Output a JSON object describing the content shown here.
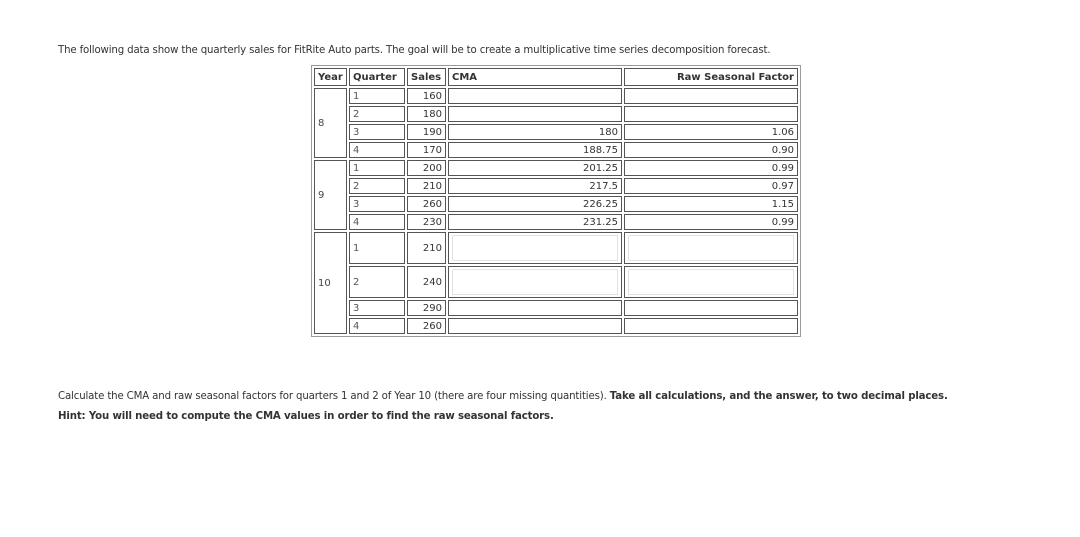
{
  "intro_text": "The following data show the quarterly sales for FitRite Auto parts. The goal will be to create a multiplicative time series decomposition forecast.",
  "table": {
    "headers": {
      "year": "Year",
      "quarter": "Quarter",
      "sales": "Sales",
      "cma": "CMA",
      "rsf": "Raw Seasonal Factor"
    },
    "groups": [
      {
        "year": "8",
        "rows": [
          {
            "quarter": "1",
            "sales": "160",
            "cma": "",
            "rsf": ""
          },
          {
            "quarter": "2",
            "sales": "180",
            "cma": "",
            "rsf": ""
          },
          {
            "quarter": "3",
            "sales": "190",
            "cma": "180",
            "rsf": "1.06"
          },
          {
            "quarter": "4",
            "sales": "170",
            "cma": "188.75",
            "rsf": "0.90"
          }
        ]
      },
      {
        "year": "9",
        "rows": [
          {
            "quarter": "1",
            "sales": "200",
            "cma": "201.25",
            "rsf": "0.99"
          },
          {
            "quarter": "2",
            "sales": "210",
            "cma": "217.5",
            "rsf": "0.97"
          },
          {
            "quarter": "3",
            "sales": "260",
            "cma": "226.25",
            "rsf": "1.15"
          },
          {
            "quarter": "4",
            "sales": "230",
            "cma": "231.25",
            "rsf": "0.99"
          }
        ]
      },
      {
        "year": "10",
        "rows": [
          {
            "quarter": "1",
            "sales": "210",
            "cma_input": "",
            "rsf_input": ""
          },
          {
            "quarter": "2",
            "sales": "240",
            "cma_input": "",
            "rsf_input": ""
          },
          {
            "quarter": "3",
            "sales": "290",
            "cma": "",
            "rsf": ""
          },
          {
            "quarter": "4",
            "sales": "260",
            "cma": "",
            "rsf": ""
          }
        ]
      }
    ]
  },
  "question": {
    "normal": "Calculate the CMA and raw seasonal factors for quarters 1 and 2 of Year 10 (there are four missing quantities). ",
    "bold": "Take all calculations, and the answer, to two decimal places."
  },
  "hint": "Hint: You will need to compute the CMA values in order to find the raw seasonal factors."
}
